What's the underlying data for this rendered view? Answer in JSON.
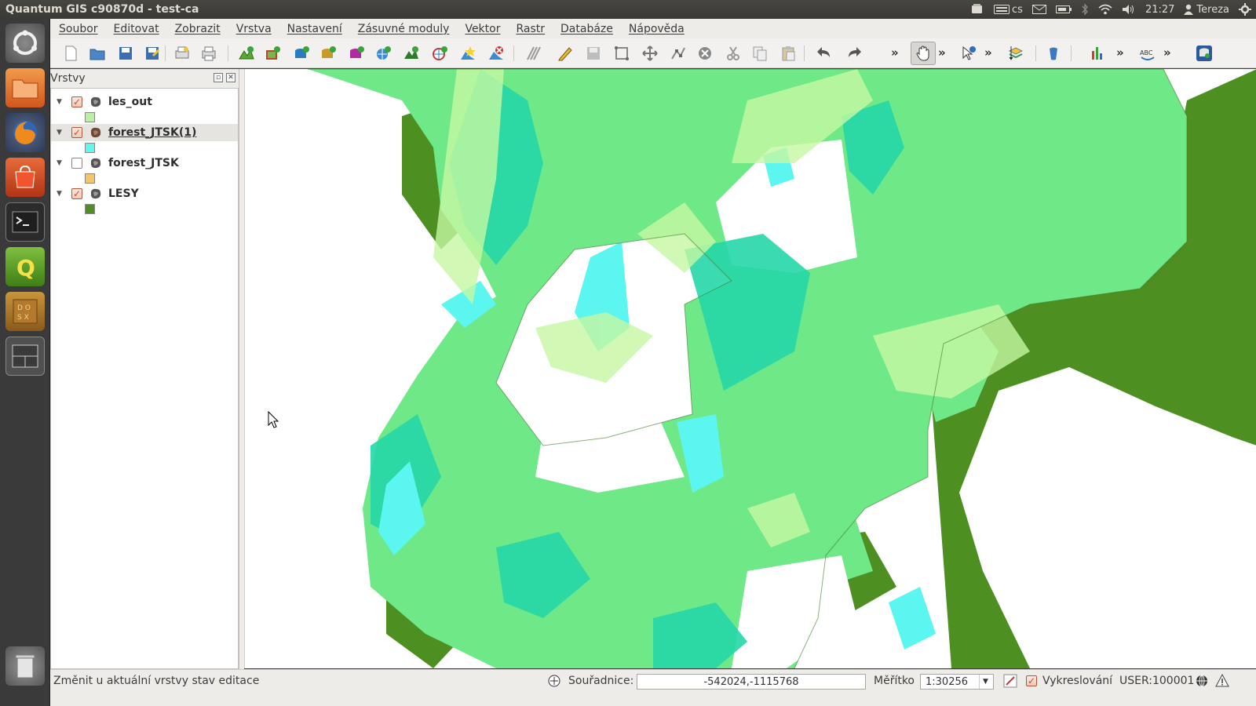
{
  "window": {
    "title": "Quantum GIS c90870d - test-ca"
  },
  "indicators": {
    "lang": "cs",
    "time": "21:27",
    "user": "Tereza"
  },
  "menu": [
    "Soubor",
    "Editovat",
    "Zobrazit",
    "Vrstva",
    "Nastavení",
    "Zásuvné moduly",
    "Vektor",
    "Rastr",
    "Databáze",
    "Nápověda"
  ],
  "layers_panel": {
    "title": "Vrstvy",
    "layers": [
      {
        "name": "les_out",
        "checked": true,
        "swatch": "#b9f0a6",
        "selected": false
      },
      {
        "name": "forest_JTSK(1)",
        "checked": true,
        "swatch": "#5ff7ee",
        "selected": true
      },
      {
        "name": "forest_JTSK",
        "checked": false,
        "swatch": "#f6c46a",
        "selected": false
      },
      {
        "name": "LESY",
        "checked": true,
        "swatch": "#4e8f22",
        "selected": false
      }
    ]
  },
  "status": {
    "message": "Změnit u aktuální vrstvy stav editace",
    "coord_label": "Souřadnice:",
    "coord_value": "-542024,-1115768",
    "scale_label": "Měřítko",
    "scale_value": "1:30256",
    "render_label": "Vykreslování",
    "crs": "USER:100001"
  },
  "colors": {
    "lesy": "#4e8f22",
    "les_out": "#6fe888",
    "forest_jtsk1": "#25d7a9",
    "cyan": "#5cf6f0",
    "light": "#c6f7a2"
  }
}
